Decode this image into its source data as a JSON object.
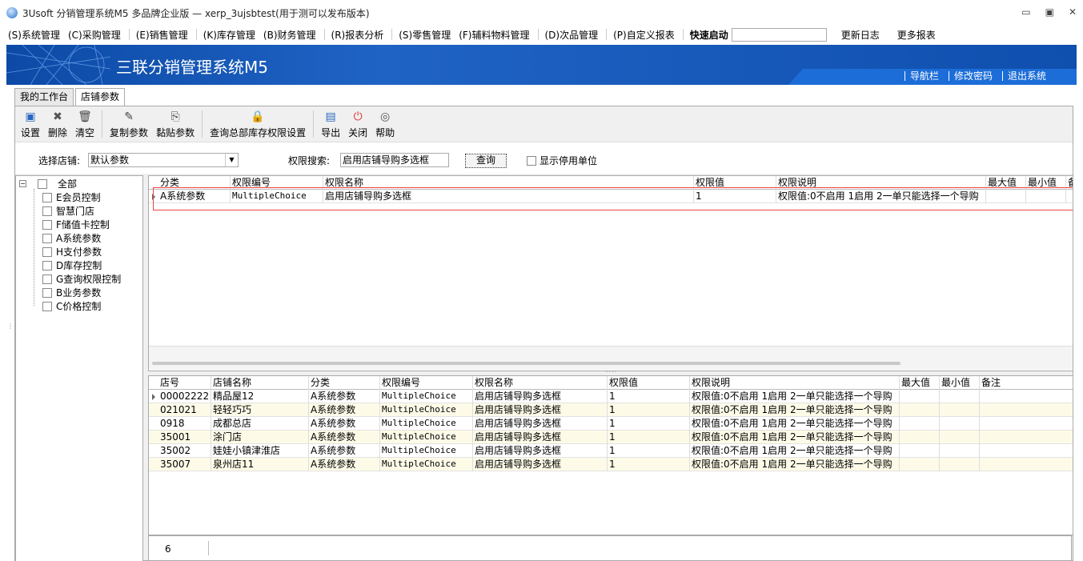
{
  "window": {
    "title": "3Usoft 分销管理系统M5 多品牌企业版 — xerp_3ujsbtest(用于测可以发布版本)",
    "controls": [
      "minimize-icon",
      "maximize-icon",
      "close-icon"
    ]
  },
  "menu": {
    "items": [
      "(S)系统管理",
      "(C)采购管理",
      "(E)销售管理",
      "(K)库存管理",
      "(B)财务管理",
      "(R)报表分析",
      "(S)零售管理",
      "(F)辅料物料管理",
      "(D)次品管理",
      "(P)自定义报表"
    ],
    "quick_start_label": "快速启动",
    "extra": [
      "更新日志",
      "更多报表"
    ]
  },
  "banner": {
    "title": "三联分销管理系统M5",
    "links": [
      "导航栏",
      "修改密码",
      "退出系统"
    ]
  },
  "tabs": [
    "我的工作台",
    "店铺参数"
  ],
  "toolbar": [
    "设置",
    "删除",
    "清空",
    "复制参数",
    "黏贴参数",
    "查询总部库存权限设置",
    "导出",
    "关闭",
    "帮助"
  ],
  "filter": {
    "store_label": "选择店铺:",
    "store_value": "默认参数",
    "search_label": "权限搜索:",
    "search_value": "启用店铺导购多选框",
    "query_button": "查询",
    "show_disabled_label": "显示停用单位"
  },
  "tree": {
    "root": "全部",
    "items": [
      "E会员控制",
      "智慧门店",
      "F储值卡控制",
      "A系统参数",
      "H支付参数",
      "D库存控制",
      "G查询权限控制",
      "B业务参数",
      "C价格控制"
    ]
  },
  "top_grid": {
    "columns": [
      "分类",
      "权限编号",
      "权限名称",
      "权限值",
      "权限说明",
      "最大值",
      "最小值",
      "备"
    ],
    "rows": [
      [
        "A系统参数",
        "MultipleChoice",
        "启用店铺导购多选框",
        "1",
        "权限值:0不启用 1启用 2一单只能选择一个导购",
        "",
        ""
      ]
    ]
  },
  "bottom_grid": {
    "columns": [
      "店号",
      "店铺名称",
      "分类",
      "权限编号",
      "权限名称",
      "权限值",
      "权限说明",
      "最大值",
      "最小值",
      "备注"
    ],
    "rows": [
      [
        "00002222",
        "精品屋12",
        "A系统参数",
        "MultipleChoice",
        "启用店铺导购多选框",
        "1",
        "权限值:0不启用 1启用 2一单只能选择一个导购",
        "",
        "",
        ""
      ],
      [
        "021021",
        "轻轻巧巧",
        "A系统参数",
        "MultipleChoice",
        "启用店铺导购多选框",
        "1",
        "权限值:0不启用 1启用 2一单只能选择一个导购",
        "",
        "",
        ""
      ],
      [
        "0918",
        "成都总店",
        "A系统参数",
        "MultipleChoice",
        "启用店铺导购多选框",
        "1",
        "权限值:0不启用 1启用 2一单只能选择一个导购",
        "",
        "",
        ""
      ],
      [
        "35001",
        "涂门店",
        "A系统参数",
        "MultipleChoice",
        "启用店铺导购多选框",
        "1",
        "权限值:0不启用 1启用 2一单只能选择一个导购",
        "",
        "",
        ""
      ],
      [
        "35002",
        "娃娃小镇津淮店",
        "A系统参数",
        "MultipleChoice",
        "启用店铺导购多选框",
        "1",
        "权限值:0不启用 1启用 2一单只能选择一个导购",
        "",
        "",
        ""
      ],
      [
        "35007",
        "泉州店11",
        "A系统参数",
        "MultipleChoice",
        "启用店铺导购多选框",
        "1",
        "权限值:0不启用 1启用 2一单只能选择一个导购",
        "",
        "",
        ""
      ]
    ],
    "row_count": "6"
  },
  "colors": {
    "banner": "#1f63c4",
    "highlight_box": "#e44444",
    "alt_row": "#fdfbe8"
  }
}
